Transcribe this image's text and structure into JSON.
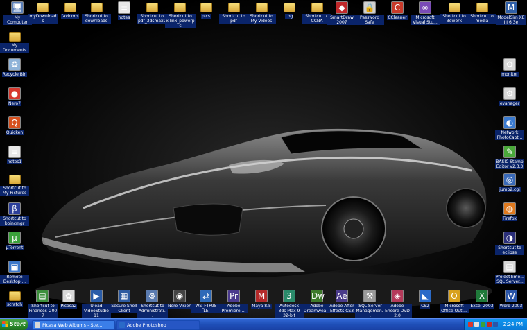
{
  "desktop_icons": [
    {
      "label": "My Computer",
      "glyph": "🖥",
      "bg": "#5b7fb8",
      "kind": "app"
    },
    {
      "label": "myDownloads",
      "kind": "folder"
    },
    {
      "label": "favicons",
      "kind": "folder"
    },
    {
      "label": "Shortcut to downloads",
      "kind": "folder"
    },
    {
      "label": "notes",
      "glyph": "≡",
      "bg": "#e8e8e8",
      "kind": "app"
    },
    {
      "label": "Shortcut to pdf_3dsmax9",
      "kind": "folder"
    },
    {
      "label": "Shortcut to xilinx_powerpc",
      "kind": "folder"
    },
    {
      "label": "pics",
      "kind": "folder"
    },
    {
      "label": "Shortcut to pdf",
      "kind": "folder"
    },
    {
      "label": "Shortcut to My Videos",
      "kind": "folder"
    },
    {
      "label": "Log",
      "kind": "folder"
    },
    {
      "label": "Shortcut to CCNA",
      "kind": "folder"
    },
    {
      "label": "SmartDraw 2007",
      "glyph": "◆",
      "bg": "#c0282a",
      "kind": "app"
    },
    {
      "label": "Password Safe",
      "glyph": "🔒",
      "bg": "#d0d0d0",
      "kind": "app"
    },
    {
      "label": "CCleaner",
      "glyph": "C",
      "bg": "#c83a2a",
      "kind": "app"
    },
    {
      "label": "Microsoft Visual Stu...",
      "glyph": "∞",
      "bg": "#7a4bb6",
      "kind": "app"
    },
    {
      "label": "Shortcut to 3dwork",
      "kind": "folder"
    },
    {
      "label": "Shortcut to media",
      "kind": "folder"
    },
    {
      "label": "ModelSim XE III 6.3e",
      "glyph": "M",
      "bg": "#2f5fa8",
      "kind": "app"
    },
    {
      "label": "My Documents",
      "kind": "folder"
    },
    {
      "label": "Recycle Bin",
      "glyph": "♻",
      "bg": "#8fb3d8",
      "kind": "app"
    },
    {
      "label": "Nero7",
      "glyph": "●",
      "bg": "#d6382e",
      "kind": "app"
    },
    {
      "label": "Quicken",
      "glyph": "Q",
      "bg": "#d6501e",
      "kind": "app"
    },
    {
      "label": "notes1",
      "glyph": "≡",
      "bg": "#e8e8e8",
      "kind": "app"
    },
    {
      "label": "Shortcut to My Pictures",
      "kind": "folder"
    },
    {
      "label": "Shortcut to boincmgr",
      "glyph": "β",
      "bg": "#2c3f9a",
      "kind": "app"
    },
    {
      "label": "µTorrent",
      "glyph": "µ",
      "bg": "#3aa23a",
      "kind": "app"
    },
    {
      "label": "Remote Desktop ...",
      "glyph": "▣",
      "bg": "#3d78c9",
      "kind": "app"
    },
    {
      "label": "scratch",
      "kind": "folder"
    },
    {
      "label": "Shortcut to Finances_2007",
      "glyph": "▤",
      "bg": "#3c8f3c",
      "kind": "app"
    },
    {
      "label": "Picasa2",
      "glyph": "✿",
      "bg": "#d8d8d8",
      "kind": "app"
    },
    {
      "label": "Ulead VideoStudio 11",
      "glyph": "▶",
      "bg": "#2a5ca8",
      "kind": "app"
    },
    {
      "label": "Secure Shell Client",
      "glyph": "▦",
      "bg": "#2d5aa0",
      "kind": "app"
    },
    {
      "label": "Shortcut to Administrati...",
      "glyph": "⚙",
      "bg": "#5a7bb0",
      "kind": "app"
    },
    {
      "label": "Nero Vision",
      "glyph": "◉",
      "bg": "#444444",
      "kind": "app"
    },
    {
      "label": "WS_FTP95 LE",
      "glyph": "⇄",
      "bg": "#2e6ab8",
      "kind": "app"
    },
    {
      "label": "Adobe Premiere ...",
      "glyph": "Pr",
      "bg": "#4b3a8e",
      "kind": "app"
    },
    {
      "label": "Maya 8.5",
      "glyph": "M",
      "bg": "#b52a2a",
      "kind": "app"
    },
    {
      "label": "Autodesk 3ds Max 9 32-bit",
      "glyph": "3",
      "bg": "#2a8a6a",
      "kind": "app"
    },
    {
      "label": "Adobe Dreamwea...",
      "glyph": "Dw",
      "bg": "#3d7a2a",
      "kind": "app"
    },
    {
      "label": "Adobe After Effects CS3",
      "glyph": "Ae",
      "bg": "#4a3a8a",
      "kind": "app"
    },
    {
      "label": "SQL Server Managemen...",
      "glyph": "⚒",
      "bg": "#9a9a9a",
      "kind": "app"
    },
    {
      "label": "Adobe Encore DVD 2.0",
      "glyph": "◈",
      "bg": "#b43a5a",
      "kind": "app"
    },
    {
      "label": "CS2",
      "glyph": "◣",
      "bg": "#2a6ac8",
      "kind": "app"
    },
    {
      "label": "Microsoft Office Outl...",
      "glyph": "O",
      "bg": "#d8a11e",
      "kind": "app"
    },
    {
      "label": "Excel 2003",
      "glyph": "X",
      "bg": "#1f7a3a",
      "kind": "app"
    },
    {
      "label": "Word 2003",
      "glyph": "W",
      "bg": "#2a55a8",
      "kind": "app"
    },
    {
      "label": "monitor",
      "glyph": "⚙",
      "bg": "#d8d8d8",
      "kind": "app"
    },
    {
      "label": "evanager",
      "glyph": "⚙",
      "bg": "#d8d8d8",
      "kind": "app"
    },
    {
      "label": "Network PhotoCapt...",
      "glyph": "◐",
      "bg": "#3a7ad0",
      "kind": "app"
    },
    {
      "label": "BASIC Stamp Editor v2.3.3",
      "glyph": "✎",
      "bg": "#4aa83a",
      "kind": "app"
    },
    {
      "label": "jump2.cgi",
      "glyph": "◎",
      "bg": "#3a6ab8",
      "kind": "app"
    },
    {
      "label": "Firefox",
      "glyph": "◍",
      "bg": "#e07a1e",
      "kind": "app"
    },
    {
      "label": "Shortcut to eclipse",
      "glyph": "◑",
      "bg": "#2b2f7a",
      "kind": "app"
    },
    {
      "label": "ProjectTime... SQL Server...",
      "glyph": "▤",
      "bg": "#d8d8d8",
      "kind": "app"
    }
  ],
  "taskbar": {
    "start_label": "Start",
    "tasks": [
      {
        "label": "Picasa Web Albums - Ste...",
        "color": "#d8d8d8"
      },
      {
        "label": "Adobe Photoshop",
        "color": "#2a6ac8"
      }
    ],
    "clock": "2:24 PM"
  }
}
